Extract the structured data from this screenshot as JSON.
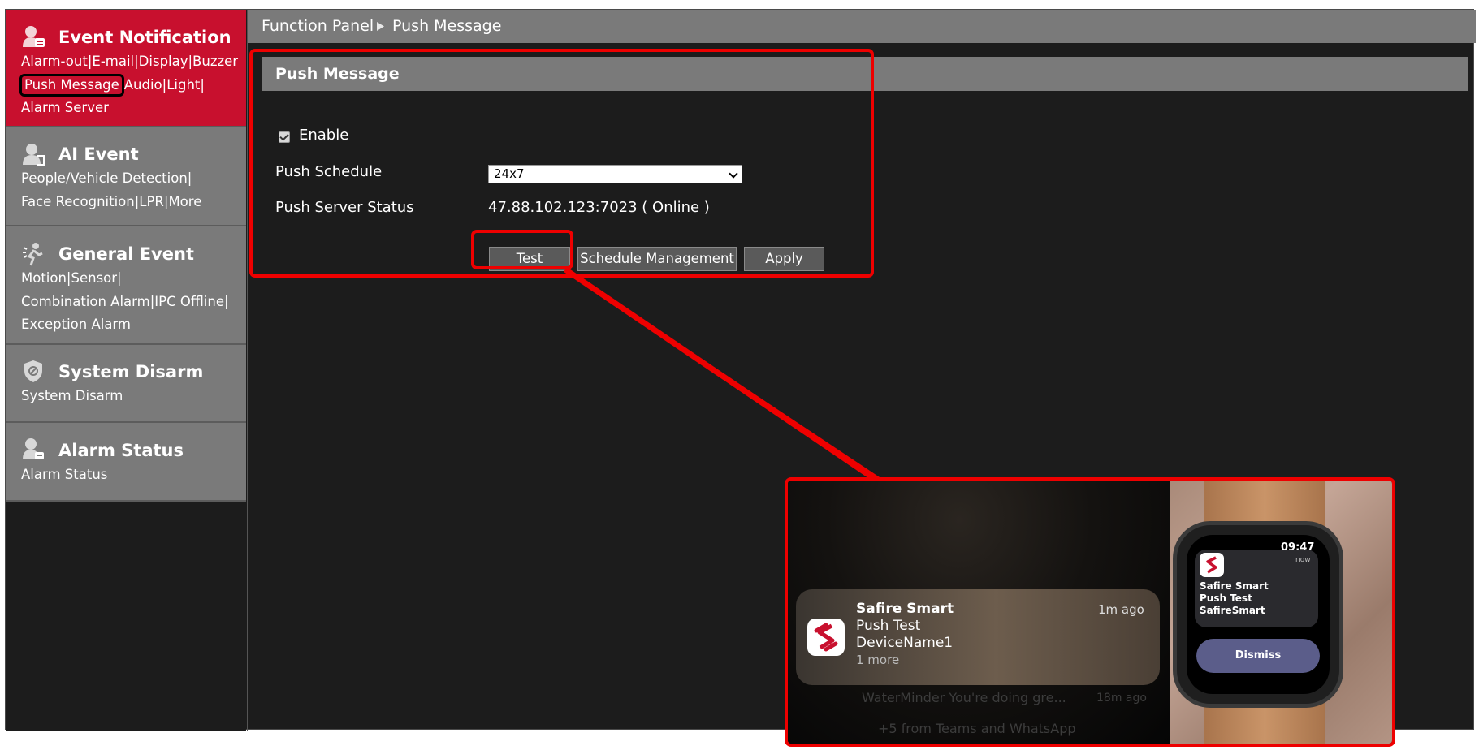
{
  "sidebar": {
    "sections": [
      {
        "title": "Event Notification",
        "icon": "bell-user-icon",
        "lines": [
          "Alarm-out|E-mail|Display|Buzzer",
          "Audio|Light|",
          "Alarm Server"
        ],
        "highlight": "Push Message"
      },
      {
        "title": "AI Event",
        "icon": "person-scan-icon",
        "lines": [
          "People/Vehicle Detection|",
          "Face Recognition|LPR|More"
        ]
      },
      {
        "title": "General Event",
        "icon": "running-person-icon",
        "lines": [
          "Motion|Sensor|",
          "Combination Alarm|IPC Offline|",
          "Exception Alarm"
        ]
      },
      {
        "title": "System Disarm",
        "icon": "shield-icon",
        "lines": [
          "System Disarm"
        ]
      },
      {
        "title": "Alarm Status",
        "icon": "alarm-person-icon",
        "lines": [
          "Alarm Status"
        ]
      }
    ]
  },
  "breadcrumb": {
    "root": "Function Panel",
    "current": "Push Message"
  },
  "panel": {
    "title": "Push Message",
    "enable_label": "Enable",
    "enable_checked": true,
    "push_schedule_label": "Push Schedule",
    "push_schedule_value": "24x7",
    "server_status_label": "Push Server Status",
    "server_status_value": "47.88.102.123:7023 ( Online )",
    "buttons": {
      "test": "Test",
      "schedule_management": "Schedule Management",
      "apply": "Apply"
    }
  },
  "phone_notification": {
    "app": "Safire Smart",
    "time": "1m ago",
    "line1": "Push Test",
    "line2": "DeviceName1",
    "more": "1 more",
    "faded_line": "WaterMinder You're doing gre...",
    "faded_time": "18m ago",
    "faded_footer": "+5 from Teams and WhatsApp"
  },
  "watch_notification": {
    "time": "09:47",
    "now": "now",
    "line1": "Safire Smart",
    "line2": "Push Test",
    "line3": "SafireSmart",
    "dismiss": "Dismiss"
  },
  "colors": {
    "active_section": "#c8102e",
    "section_bg": "#7a7a7a",
    "annotation": "#ee0000"
  }
}
